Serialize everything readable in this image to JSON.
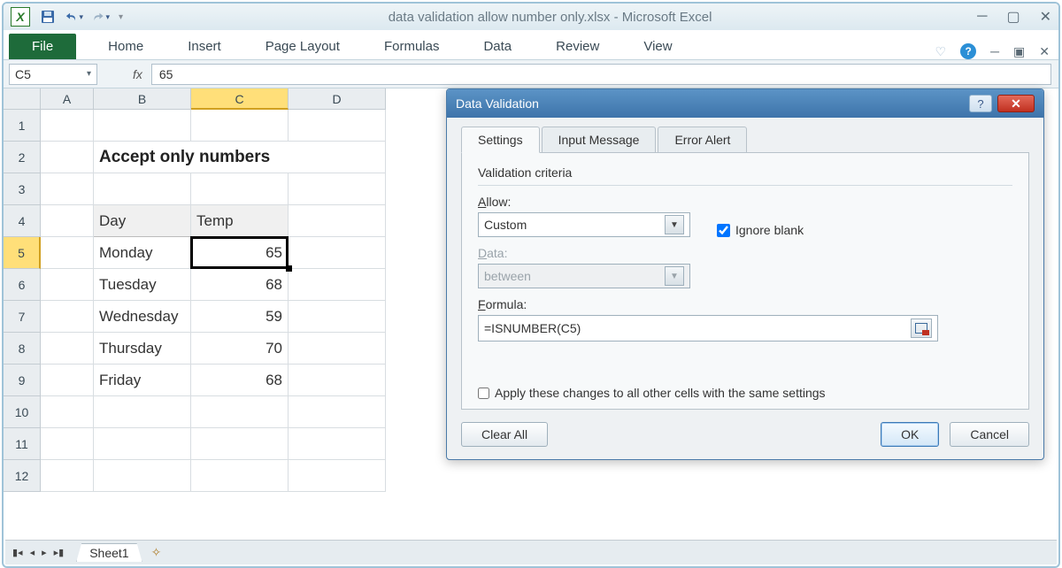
{
  "window": {
    "title": "data validation allow number only.xlsx  -  Microsoft Excel",
    "logo_letter": "X"
  },
  "qat": {
    "save_icon": "save-icon",
    "undo_icon": "undo-icon",
    "redo_icon": "redo-icon"
  },
  "ribbon": {
    "file": "File",
    "tabs": [
      "Home",
      "Insert",
      "Page Layout",
      "Formulas",
      "Data",
      "Review",
      "View"
    ]
  },
  "formula_bar": {
    "name_box": "C5",
    "fx": "fx",
    "formula": "65"
  },
  "columns": [
    "A",
    "B",
    "C",
    "D"
  ],
  "selected_column": "C",
  "rows": [
    1,
    2,
    3,
    4,
    5,
    6,
    7,
    8,
    9,
    10,
    11,
    12
  ],
  "selected_row": 5,
  "cells": {
    "B2": "Accept only numbers",
    "B4": "Day",
    "C4": "Temp",
    "B5": "Monday",
    "C5": "65",
    "B6": "Tuesday",
    "C6": "68",
    "B7": "Wednesday",
    "C7": "59",
    "B8": "Thursday",
    "C8": "70",
    "B9": "Friday",
    "C9": "68"
  },
  "sheet_tabs": {
    "active": "Sheet1"
  },
  "dialog": {
    "title": "Data Validation",
    "tabs": [
      "Settings",
      "Input Message",
      "Error Alert"
    ],
    "active_tab": "Settings",
    "criteria_label": "Validation criteria",
    "allow_label": "Allow:",
    "allow_value": "Custom",
    "ignore_blank_label": "Ignore blank",
    "ignore_blank_checked": true,
    "data_label": "Data:",
    "data_value": "between",
    "formula_label": "Formula:",
    "formula_value": "=ISNUMBER(C5)",
    "apply_label": "Apply these changes to all other cells with the same settings",
    "apply_checked": false,
    "clear_all": "Clear All",
    "ok": "OK",
    "cancel": "Cancel"
  }
}
